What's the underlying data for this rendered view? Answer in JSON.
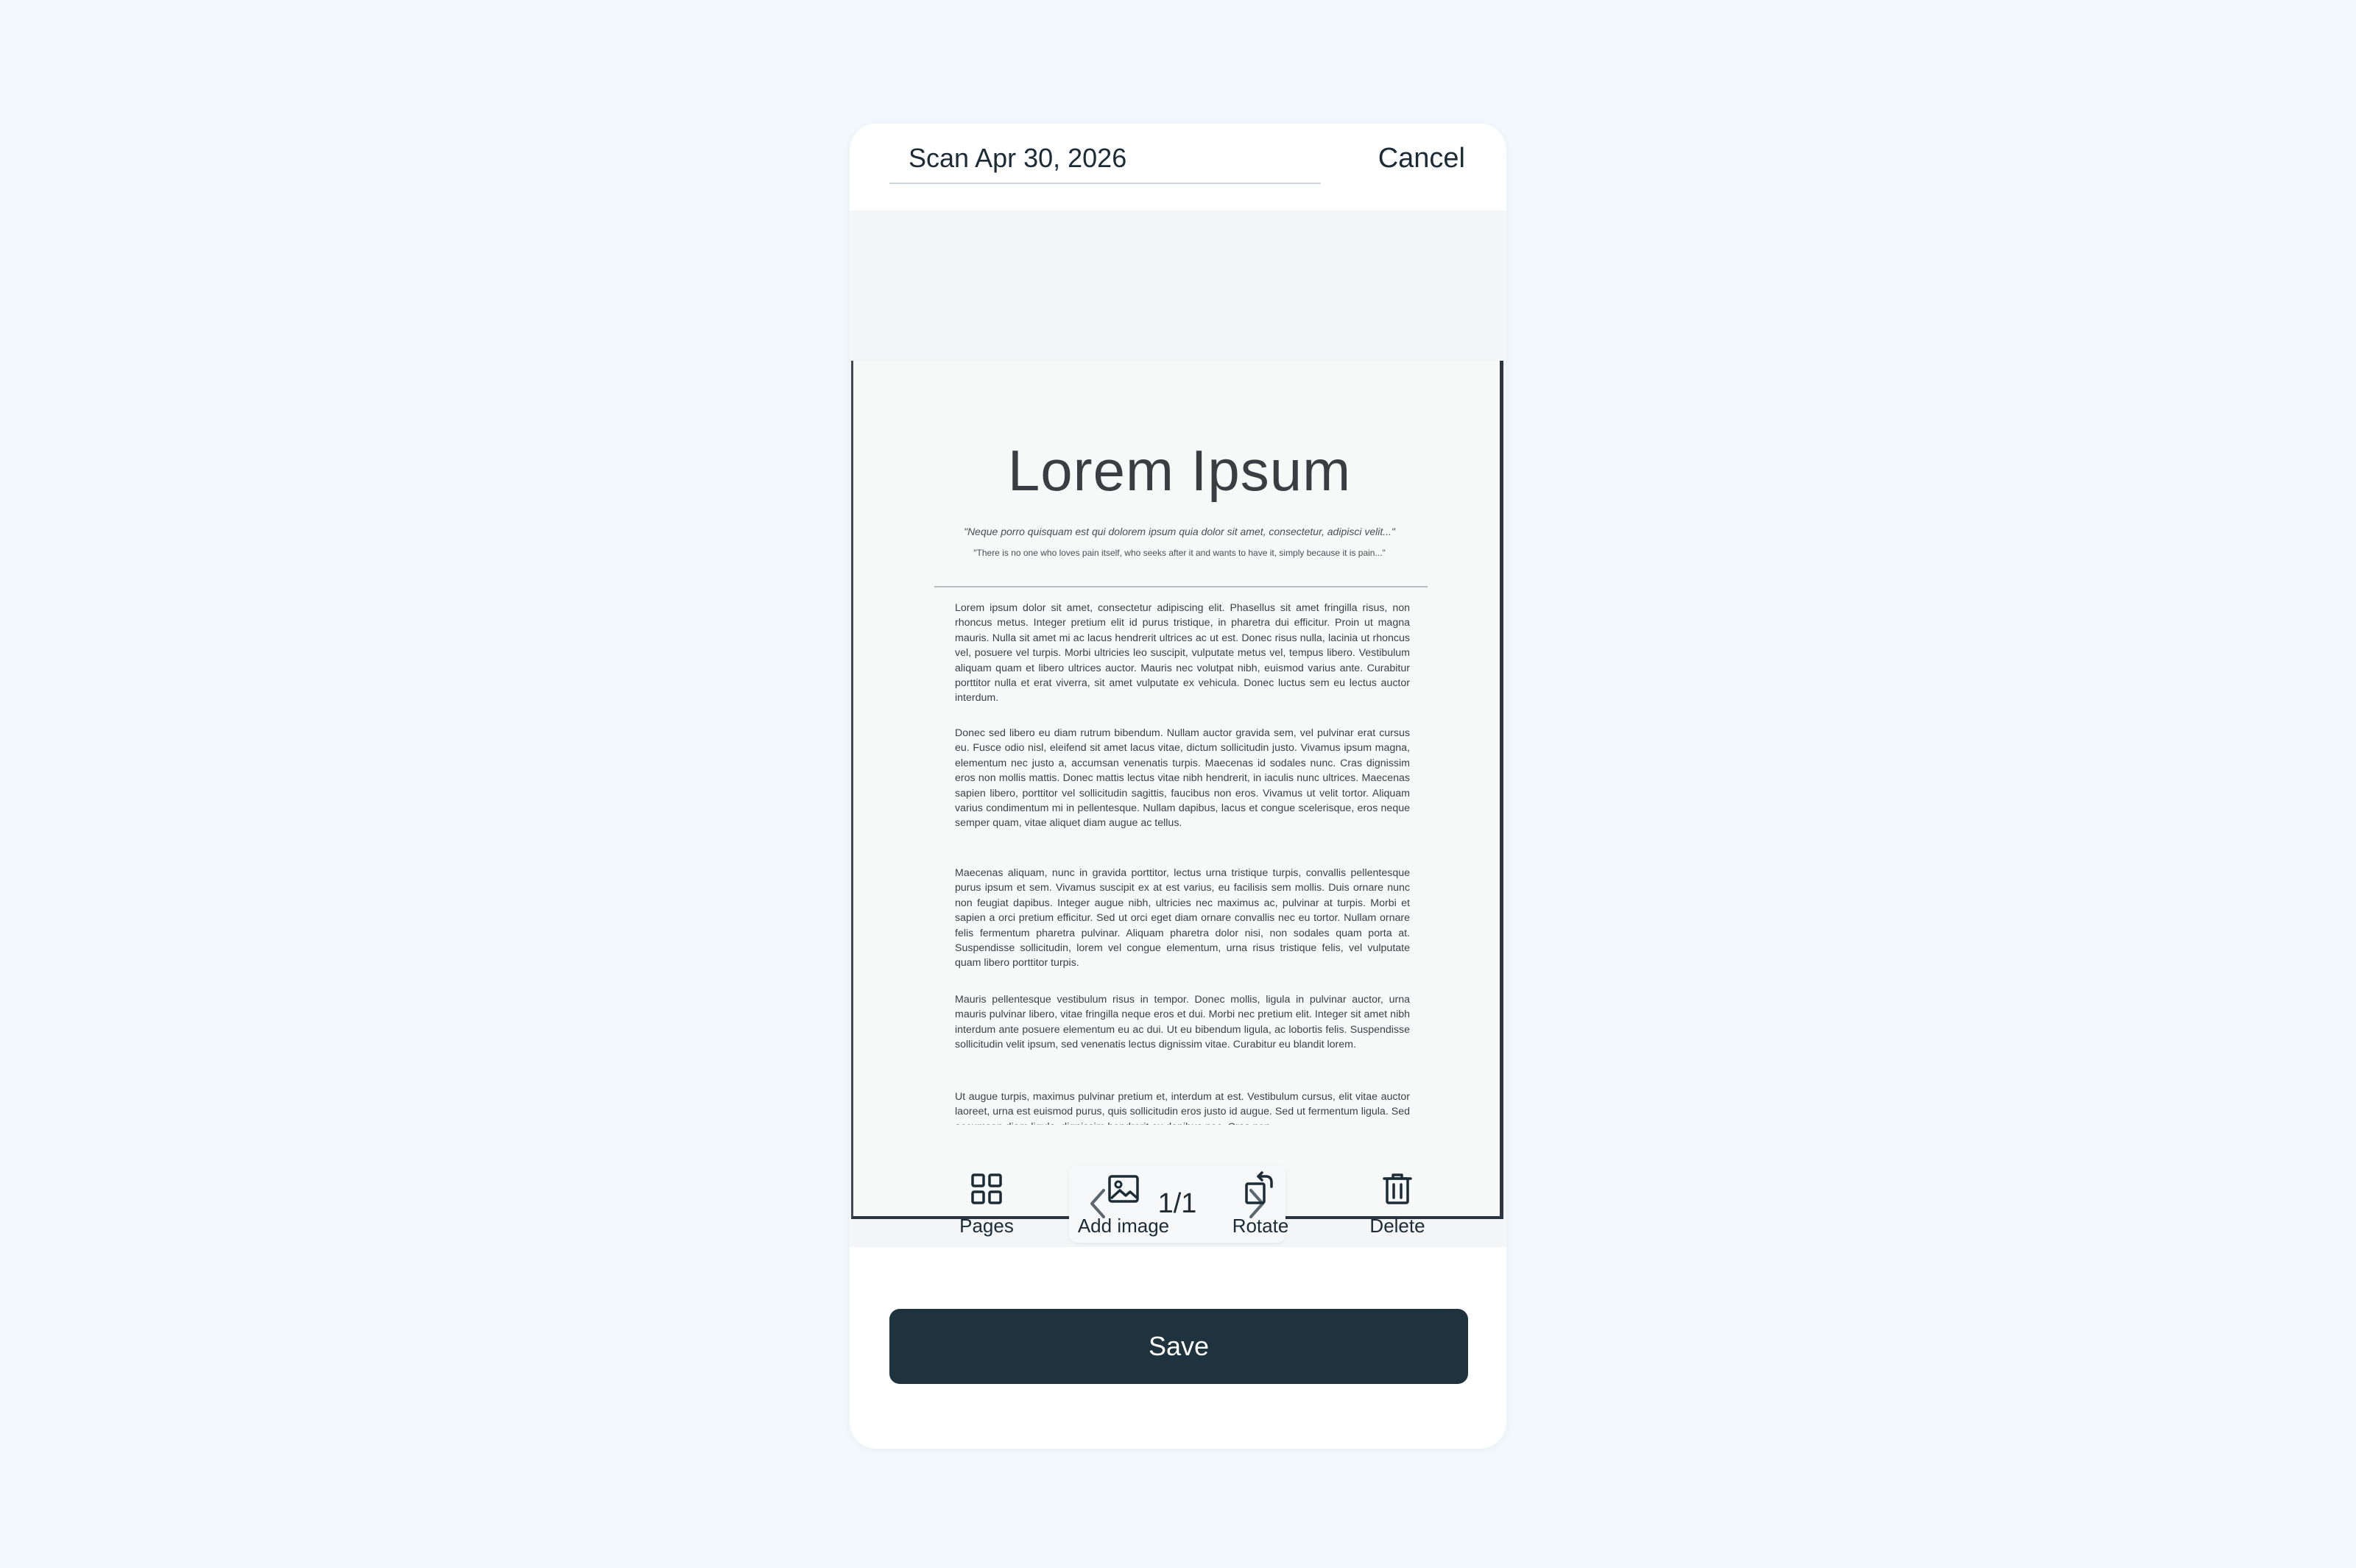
{
  "header": {
    "title": "Scan Apr 30, 2026",
    "cancel_label": "Cancel"
  },
  "document": {
    "title": "Lorem Ipsum",
    "quote_line_1": "\"Neque porro quisquam est qui dolorem ipsum quia dolor sit amet, consectetur, adipisci velit...\"",
    "quote_line_2": "\"There is no one who loves pain itself, who seeks after it and wants to have it, simply because it is pain...\"",
    "paragraphs": [
      "Lorem ipsum dolor sit amet, consectetur adipiscing elit. Phasellus sit amet fringilla risus, non rhoncus metus. Integer pretium elit id purus tristique, in pharetra dui efficitur. Proin ut magna mauris. Nulla sit amet mi ac lacus hendrerit ultrices ac ut est. Donec risus nulla, lacinia ut rhoncus vel, posuere vel turpis. Morbi ultricies leo suscipit, vulputate metus vel, tempus libero. Vestibulum aliquam quam et libero ultrices auctor. Mauris nec volutpat nibh, euismod varius ante. Curabitur porttitor nulla et erat viverra, sit amet vulputate ex vehicula. Donec luctus sem eu lectus auctor interdum.",
      "Donec sed libero eu diam rutrum bibendum. Nullam auctor gravida sem, vel pulvinar erat cursus eu. Fusce odio nisl, eleifend sit amet lacus vitae, dictum sollicitudin justo. Vivamus ipsum magna, elementum nec justo a, accumsan venenatis turpis. Maecenas id sodales nunc. Cras dignissim eros non mollis mattis. Donec mattis lectus vitae nibh hendrerit, in iaculis nunc ultrices. Maecenas sapien libero, porttitor vel sollicitudin sagittis, faucibus non eros. Vivamus ut velit tortor. Aliquam varius condimentum mi in pellentesque. Nullam dapibus, lacus et congue scelerisque, eros neque semper quam, vitae aliquet diam augue ac tellus.",
      "Maecenas aliquam, nunc in gravida porttitor, lectus urna tristique turpis, convallis pellentesque purus ipsum et sem. Vivamus suscipit ex at est varius, eu facilisis sem mollis. Duis ornare nunc non feugiat dapibus. Integer augue nibh, ultricies nec maximus ac, pulvinar at turpis. Morbi et sapien a orci pretium efficitur. Sed ut orci eget diam ornare convallis nec eu tortor. Nullam ornare felis fermentum pharetra pulvinar. Aliquam pharetra dolor nisi, non sodales quam porta at. Suspendisse sollicitudin, lorem vel congue elementum, urna risus tristique felis, vel vulputate quam libero porttitor turpis.",
      "Mauris pellentesque vestibulum risus in tempor. Donec mollis, ligula in pulvinar auctor, urna mauris pulvinar libero, vitae fringilla neque eros et dui. Morbi nec pretium elit. Integer sit amet nibh interdum ante posuere elementum eu ac dui. Ut eu bibendum ligula, ac lobortis felis. Suspendisse sollicitudin velit ipsum, sed venenatis lectus dignissim vitae. Curabitur eu blandit lorem.",
      "Ut augue turpis, maximus pulvinar pretium et, interdum at est. Vestibulum cursus, elit vitae auctor laoreet, urna est euismod purus, quis sollicitudin eros justo id augue. Sed ut fermentum ligula. Sed accumsan diam ligula, dignissim hendrerit ex dapibus nec. Cras non"
    ]
  },
  "pager": {
    "label": "1/1"
  },
  "toolbar": {
    "pages_label": "Pages",
    "add_image_label": "Add image",
    "rotate_label": "Rotate",
    "delete_label": "Delete"
  },
  "save_label": "Save",
  "colors": {
    "background": "#f2f9fd",
    "save_button": "#1e333e"
  }
}
